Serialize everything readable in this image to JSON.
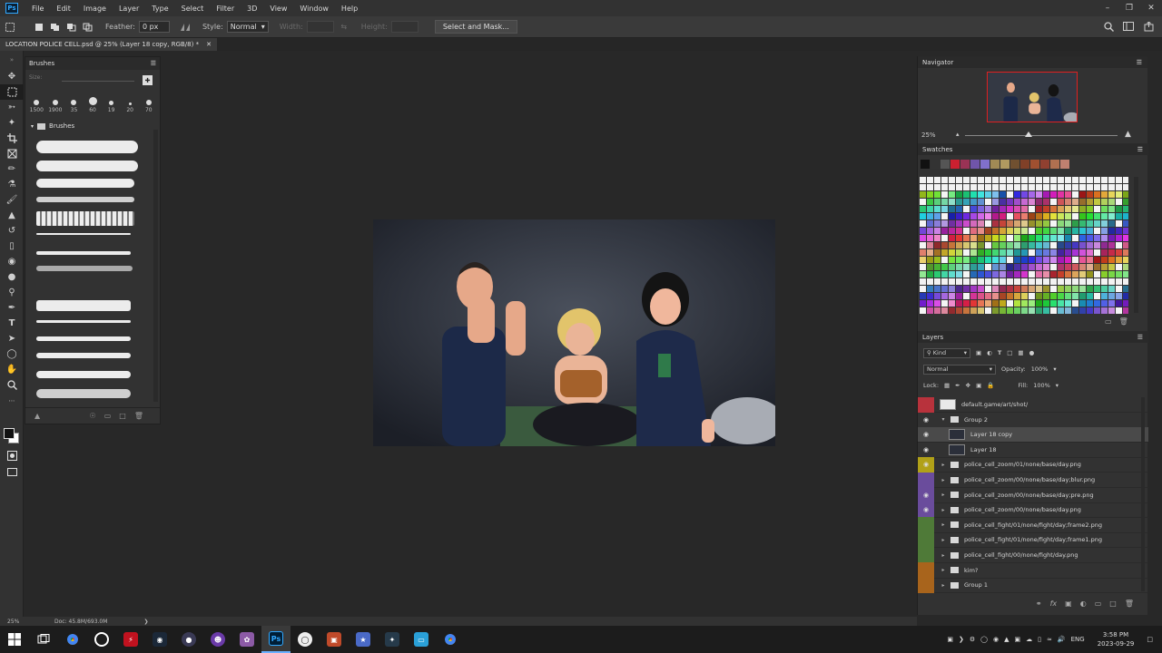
{
  "app": {
    "logo": "Ps"
  },
  "menu": [
    "File",
    "Edit",
    "Image",
    "Layer",
    "Type",
    "Select",
    "Filter",
    "3D",
    "View",
    "Window",
    "Help"
  ],
  "options": {
    "feather_label": "Feather:",
    "feather_value": "0 px",
    "style_label": "Style:",
    "style_value": "Normal",
    "width_label": "Width:",
    "height_label": "Height:",
    "select_mask": "Select and Mask..."
  },
  "document": {
    "tab_title": "LOCATION POLICE CELL.psd @ 25% (Layer 18 copy, RGB/8) *"
  },
  "brushes": {
    "title": "Brushes",
    "size_label": "Size:",
    "presets": [
      {
        "num": "1500",
        "d": 6
      },
      {
        "num": "1900",
        "d": 6
      },
      {
        "num": "35",
        "d": 6
      },
      {
        "num": "60",
        "d": 9
      },
      {
        "num": "19",
        "d": 5
      },
      {
        "num": "20",
        "d": 3
      },
      {
        "num": "70",
        "d": 6
      }
    ],
    "folder": "Brushes"
  },
  "navigator": {
    "title": "Navigator",
    "zoom": "25%"
  },
  "swatches": {
    "title": "Swatches",
    "recent": [
      "#111111",
      "#333333",
      "#555555",
      "#cc2030",
      "#993355",
      "#7055aa",
      "#8070cc",
      "#a08a55",
      "#b09a60",
      "#705030",
      "#804028",
      "#a05030",
      "#904030",
      "#b07050",
      "#c08070"
    ]
  },
  "layers": {
    "title": "Layers",
    "kind_label": "Kind",
    "blend_mode": "Normal",
    "opacity_label": "Opacity:",
    "opacity_value": "100%",
    "lock_label": "Lock:",
    "fill_label": "Fill:",
    "fill_value": "100%",
    "rows": [
      {
        "name": "default.game/art/shot/",
        "color": "#b8323c",
        "eye": false,
        "type": "text",
        "selected": false
      },
      {
        "name": "Group 2",
        "color": "",
        "eye": true,
        "type": "group-open",
        "selected": false
      },
      {
        "name": "Layer 18 copy",
        "color": "",
        "eye": true,
        "type": "layer",
        "selected": true
      },
      {
        "name": "Layer 18",
        "color": "",
        "eye": true,
        "type": "layer",
        "selected": false
      },
      {
        "name": "police_cell_zoom/01/none/base/day.png",
        "color": "#b1a118",
        "eye": true,
        "type": "group",
        "selected": false
      },
      {
        "name": "police_cell_zoom/00/none/base/day;blur.png",
        "color": "#6a4c9c",
        "eye": false,
        "type": "group",
        "selected": false
      },
      {
        "name": "police_cell_zoom/00/none/base/day;pre.png",
        "color": "#6a4c9c",
        "eye": true,
        "type": "group",
        "selected": false
      },
      {
        "name": "police_cell_zoom/00/none/base/day.png",
        "color": "#6a4c9c",
        "eye": true,
        "type": "group",
        "selected": false
      },
      {
        "name": "police_cell_fight/01/none/fight/day;frame2.png",
        "color": "#4f7a38",
        "eye": false,
        "type": "group",
        "selected": false
      },
      {
        "name": "police_cell_fight/01/none/fight/day;frame1.png",
        "color": "#4f7a38",
        "eye": false,
        "type": "group",
        "selected": false
      },
      {
        "name": "police_cell_fight/00/none/fight/day.png",
        "color": "#4f7a38",
        "eye": false,
        "type": "group",
        "selected": false
      },
      {
        "name": "kim?",
        "color": "#a8641c",
        "eye": false,
        "type": "group",
        "selected": false
      },
      {
        "name": "Group 1",
        "color": "#a8641c",
        "eye": false,
        "type": "group",
        "selected": false
      }
    ]
  },
  "status": {
    "zoom": "25%",
    "doc": "Doc: 45.8M/693.0M"
  },
  "taskbar": {
    "lang": "ENG",
    "time": "3:58 PM",
    "date": "2023-09-29"
  }
}
